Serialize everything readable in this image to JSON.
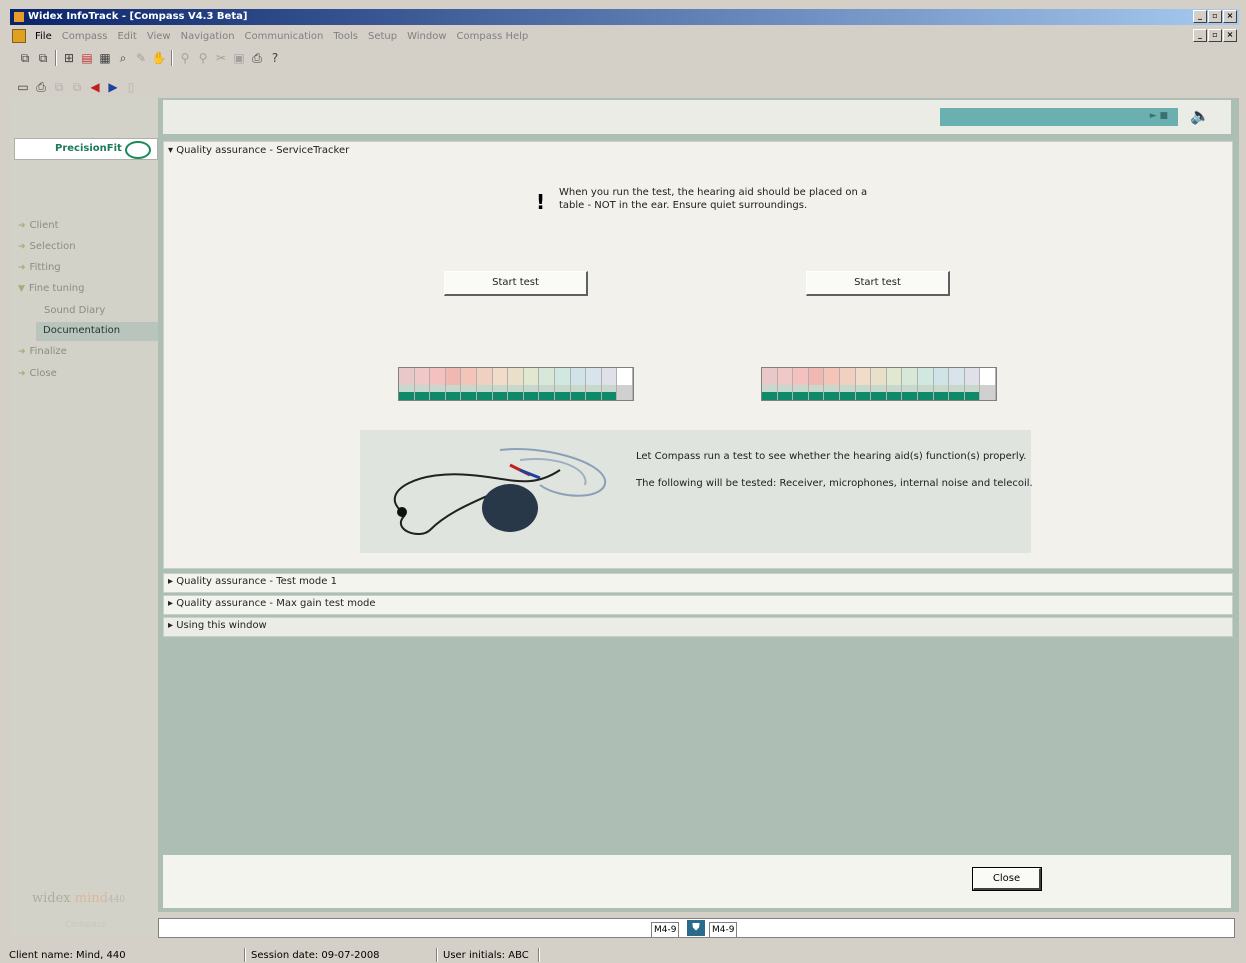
{
  "window": {
    "title": "Widex InfoTrack - [Compass V4.3 Beta]"
  },
  "menu": [
    "File",
    "Compass",
    "Edit",
    "View",
    "Navigation",
    "Communication",
    "Tools",
    "Setup",
    "Window",
    "Compass Help"
  ],
  "brand": {
    "name": "PrecisionFit"
  },
  "nav": {
    "client": "Client",
    "selection": "Selection",
    "fitting": "Fitting",
    "fine_tuning": "Fine tuning",
    "sound_diary": "Sound Diary",
    "documentation": "Documentation",
    "finalize": "Finalize",
    "close": "Close"
  },
  "sidebar_footer": {
    "brand": "widex",
    "mind": "mind",
    "model": "440",
    "compass": "Compass"
  },
  "main": {
    "section_title": "Quality assurance - ServiceTracker",
    "warning": "When you run the test, the hearing aid should be placed on a table - NOT in the ear. Ensure quiet surroundings.",
    "start_left": "Start test",
    "start_right": "Start test",
    "info_line1": "Let Compass run a test to see whether the hearing aid(s) function(s) properly.",
    "info_line2": "The following will be tested: Receiver, microphones, internal noise and telecoil."
  },
  "sections": {
    "test_mode": "Quality assurance - Test mode 1",
    "max_gain": "Quality assurance - Max gain test mode",
    "using": "Using this window"
  },
  "footer": {
    "close": "Close"
  },
  "devices": {
    "left": "M4-9",
    "right": "M4-9"
  },
  "status": {
    "client": "Client name: Mind, 440",
    "session": "Session date: 09-07-2008",
    "user": "User initials: ABC"
  },
  "meter_colors": [
    "#e8c8c8",
    "#f0c8c8",
    "#f4c0c0",
    "#f0b8b0",
    "#f4c4b8",
    "#f0d0c0",
    "#f0dcc8",
    "#e8e0c8",
    "#e0e8d0",
    "#d8e8d8",
    "#d0e8e0",
    "#d0e4e8",
    "#d8e4ec",
    "#e0e0e8",
    "#ffffff"
  ]
}
